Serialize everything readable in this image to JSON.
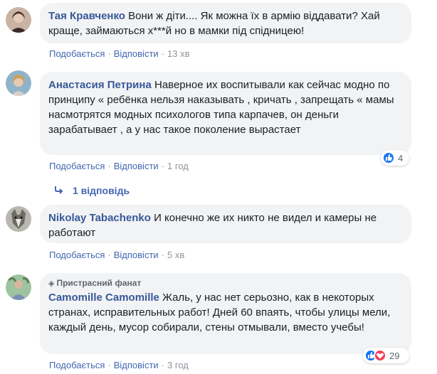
{
  "comments": [
    {
      "author": "Тая Кравченко",
      "text": "Вони ж діти.... Як можна їх в армію віддавати? Хай краще, займаються х***й но в мамки під спідницею!",
      "actions": {
        "like": "Подобається",
        "reply": "Відповісти",
        "time": "13 хв"
      }
    },
    {
      "author": "Анастасия Петрина",
      "text": "Наверное их воспитывали как сейчас модно по принципу « ребёнка нельзя наказывать , кричать , запрещать « мамы насмотрятся модных психологов типа карпачев, он деньги зарабатывает , а у нас такое поколение вырастает",
      "actions": {
        "like": "Подобається",
        "reply": "Відповісти",
        "time": "1 год"
      },
      "reactions": {
        "count": "4",
        "icons": [
          "like-icon"
        ]
      },
      "replies_label": "1 відповідь"
    },
    {
      "author": "Nikolay Tabachenko",
      "text": "И конечно же их никто не видел и камеры не работают",
      "actions": {
        "like": "Подобається",
        "reply": "Відповісти",
        "time": "5 хв"
      }
    },
    {
      "badge": "Пристрасний фанат",
      "author": "Camomille Camomille",
      "text": "Жаль, у нас нет серьозно, как в некоторых странах, исправительных работ! Дней 60 впаять, чтобы улицы мели, каждый день, мусор собирали, стены отмывали, вместо учебы!",
      "actions": {
        "like": "Подобається",
        "reply": "Відповісти",
        "time": "3 год"
      },
      "reactions": {
        "count": "29",
        "icons": [
          "like-icon",
          "love-icon"
        ]
      }
    }
  ],
  "colors": {
    "author": "#385898",
    "link": "#4267b2",
    "bubble": "#f2f3f5",
    "meta": "#90949c"
  }
}
